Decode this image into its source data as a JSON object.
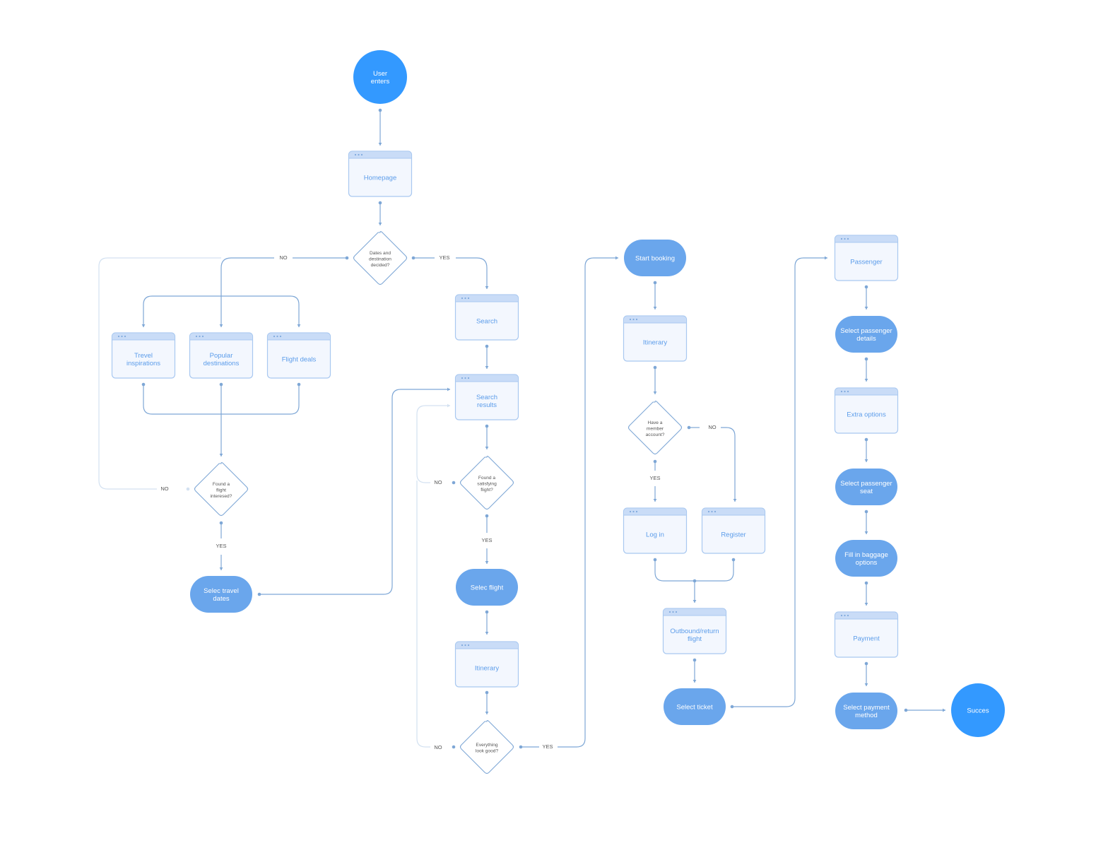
{
  "colors": {
    "terminal": "#3399ff",
    "action": "#6aa6ec",
    "page_fill": "#f3f7fe",
    "page_border": "#a9c8f0",
    "page_header": "#c9dcf7",
    "page_text": "#5b9cea",
    "connector": "#7ea7d6",
    "loop_connector": "#d3e1f1"
  },
  "nodes": [
    {
      "id": "user-enters",
      "type": "terminal",
      "lines": [
        "User",
        "enters"
      ]
    },
    {
      "id": "homepage",
      "type": "page",
      "lines": [
        "Homepage"
      ]
    },
    {
      "id": "dates-decided",
      "type": "decision",
      "lines": [
        "Dates and",
        "destination",
        "decided?"
      ]
    },
    {
      "id": "search",
      "type": "page",
      "lines": [
        "Search"
      ]
    },
    {
      "id": "travel-inspirations",
      "type": "page",
      "lines": [
        "Trevel",
        "inspirations"
      ]
    },
    {
      "id": "popular-destinations",
      "type": "page",
      "lines": [
        "Popular",
        "destinations"
      ]
    },
    {
      "id": "flight-deals",
      "type": "page",
      "lines": [
        "Flight deals"
      ]
    },
    {
      "id": "found-flight-interested",
      "type": "decision",
      "lines": [
        "Found a",
        "flight",
        "interesed?"
      ]
    },
    {
      "id": "select-travel-dates",
      "type": "action",
      "lines": [
        "Selec travel",
        "dates"
      ]
    },
    {
      "id": "search-results",
      "type": "page",
      "lines": [
        "Search",
        "results"
      ]
    },
    {
      "id": "found-satisfying",
      "type": "decision",
      "lines": [
        "Found a",
        "satisfying",
        "flight?"
      ]
    },
    {
      "id": "select-flight",
      "type": "action",
      "lines": [
        "Selec flight"
      ]
    },
    {
      "id": "itinerary-1",
      "type": "page",
      "lines": [
        "Itinerary"
      ]
    },
    {
      "id": "everything-good",
      "type": "decision",
      "lines": [
        "Everything",
        "look good?"
      ]
    },
    {
      "id": "start-booking",
      "type": "action",
      "lines": [
        "Start booking"
      ]
    },
    {
      "id": "itinerary-2",
      "type": "page",
      "lines": [
        "Itinerary"
      ]
    },
    {
      "id": "member-account",
      "type": "decision",
      "lines": [
        "Have a",
        "member",
        "account?"
      ]
    },
    {
      "id": "log-in",
      "type": "page",
      "lines": [
        "Log in"
      ]
    },
    {
      "id": "register",
      "type": "page",
      "lines": [
        "Register"
      ]
    },
    {
      "id": "outbound-return",
      "type": "page",
      "lines": [
        "Outbound/return",
        "flight"
      ]
    },
    {
      "id": "select-ticket",
      "type": "action",
      "lines": [
        "Select ticket"
      ]
    },
    {
      "id": "passenger",
      "type": "page",
      "lines": [
        "Passenger"
      ]
    },
    {
      "id": "passenger-details",
      "type": "action",
      "lines": [
        "Select passenger",
        "details"
      ]
    },
    {
      "id": "extra-options",
      "type": "page",
      "lines": [
        "Extra options"
      ]
    },
    {
      "id": "passenger-seat",
      "type": "action",
      "lines": [
        "Select passenger",
        "seat"
      ]
    },
    {
      "id": "baggage-options",
      "type": "action",
      "lines": [
        "Fill in baggage",
        "options"
      ]
    },
    {
      "id": "payment",
      "type": "page",
      "lines": [
        "Payment"
      ]
    },
    {
      "id": "payment-method",
      "type": "action",
      "lines": [
        "Select payment",
        "method"
      ]
    },
    {
      "id": "success",
      "type": "terminal",
      "lines": [
        "Succes"
      ]
    }
  ],
  "edge_labels": {
    "dates_yes": "YES",
    "dates_no": "NO",
    "interested_no": "NO",
    "interested_yes": "YES",
    "satisfying_no": "NO",
    "satisfying_yes": "YES",
    "good_no": "NO",
    "good_yes": "YES",
    "member_yes": "YES",
    "member_no": "NO"
  }
}
